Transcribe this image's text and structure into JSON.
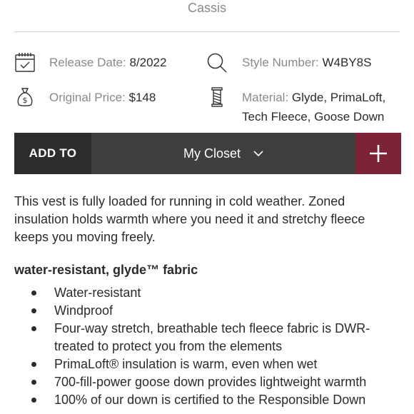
{
  "product": {
    "color_name": "Cassis"
  },
  "specs": {
    "release_date": {
      "label": "Release Date:",
      "value": "8/2022",
      "icon": "calendar-icon"
    },
    "style_number": {
      "label": "Style Number:",
      "value": "W4BY8S",
      "icon": "search-icon"
    },
    "original_price": {
      "label": "Original Price:",
      "value": "$148",
      "icon": "money-bag-icon"
    },
    "material": {
      "label": "Material:",
      "value_line1": "Glyde, PrimaLoft,",
      "value_line2": "Tech Fleece, Goose Down",
      "icon": "thread-spool-icon"
    }
  },
  "closet_bar": {
    "add_to_label": "ADD TO",
    "selected_closet": "My Closet",
    "add_icon": "plus-icon"
  },
  "description": "This vest is fully loaded for running in cold weather. Zoned insulation holds warmth where you need it and stretchy fleece keeps you moving freely.",
  "features": {
    "title": "water-resistant, glyde™ fabric",
    "items": [
      "Water-resistant",
      "Windproof",
      "Four-way stretch, breathable tech fleece fabric is DWR-treated to protect you from the elements",
      "PrimaLoft® insulation is warm, even when wet",
      "700-fill-power goose down provides lightweight warmth",
      "100% of our down is certified to the Responsible Down"
    ]
  },
  "colors": {
    "accent": "#7c2337",
    "bar_dark": "#2c2c2c",
    "bar": "#3f3f3f"
  }
}
